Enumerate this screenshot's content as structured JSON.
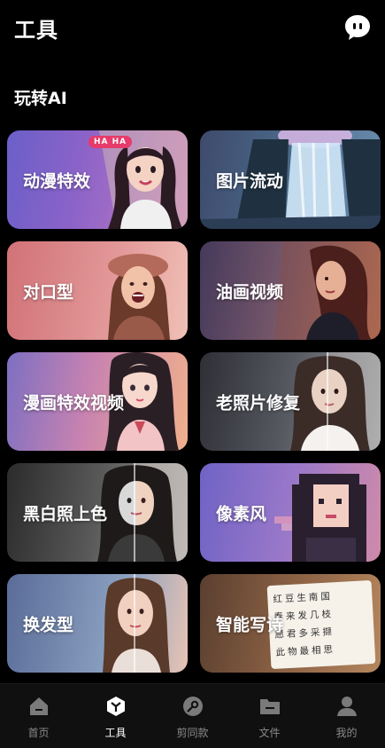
{
  "header": {
    "title": "工具",
    "chat_icon": "chat-bubble-icon"
  },
  "section": {
    "title": "玩转AI"
  },
  "cards": [
    {
      "label": "动漫特效",
      "badge": "HA HA"
    },
    {
      "label": "图片流动"
    },
    {
      "label": "对口型"
    },
    {
      "label": "油画视频"
    },
    {
      "label": "漫画特效视频"
    },
    {
      "label": "老照片修复"
    },
    {
      "label": "黑白照上色"
    },
    {
      "label": "像素风"
    },
    {
      "label": "换发型"
    },
    {
      "label": "智能写诗",
      "poem": [
        "红豆生南国",
        "春来发几枝",
        "愿君多采撷",
        "此物最相思"
      ]
    }
  ],
  "tabbar": {
    "tabs": [
      {
        "label": "首页",
        "icon": "home-icon"
      },
      {
        "label": "工具",
        "icon": "tools-cube-icon",
        "active": true
      },
      {
        "label": "剪同款",
        "icon": "template-icon"
      },
      {
        "label": "文件",
        "icon": "folder-icon"
      },
      {
        "label": "我的",
        "icon": "profile-icon"
      }
    ]
  },
  "colors": {
    "background": "#000000",
    "tabbar_bg": "#101010",
    "tab_inactive": "#8a8a8a",
    "tab_active": "#ffffff"
  }
}
